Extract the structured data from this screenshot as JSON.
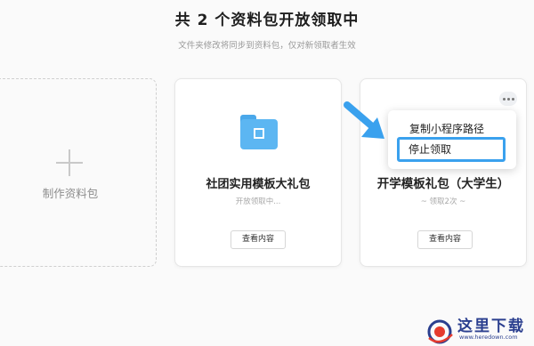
{
  "header": {
    "title": "共 2 个资料包开放领取中",
    "subtitle": "文件夹修改将同步到资料包，仅对新领取者生效"
  },
  "new_card": {
    "label": "制作资料包"
  },
  "cards": [
    {
      "name": "社团实用模板大礼包",
      "status": "开放领取中...",
      "button": "查看内容",
      "icon": "folder-qr-icon"
    },
    {
      "name": "开学模板礼包（大学生）",
      "status": "~ 领取2次 ~",
      "button": "查看内容"
    }
  ],
  "menu": {
    "items": [
      "复制小程序路径",
      "停止领取"
    ],
    "highlight_color": "#3aa1ee"
  },
  "watermark": {
    "brand": "这里下载",
    "url": "www.heredown.com"
  },
  "colors": {
    "accent": "#3aa1ee",
    "folder": "#5cb6f2"
  }
}
